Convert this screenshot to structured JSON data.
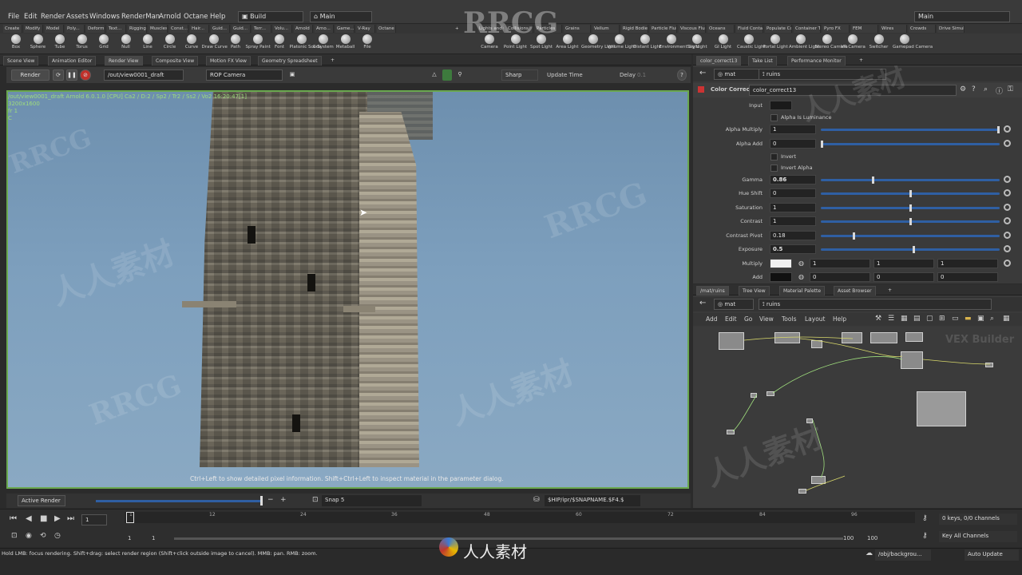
{
  "menubar": {
    "items": [
      "File",
      "Edit",
      "Render",
      "Assets",
      "Windows",
      "RenderMan",
      "Arnold",
      "Octane",
      "Help"
    ],
    "desktop": "Build",
    "context": "Main",
    "right_context": "Main"
  },
  "shelf_tabs": [
    "Create",
    "Modify",
    "Model",
    "Poly...",
    "Deform",
    "Text...",
    "Rigging",
    "Muscles",
    "Const...",
    "Hair...",
    "Guid...",
    "Guid...",
    "Terr...",
    "Volu...",
    "Arnold",
    "Arno...",
    "Game...",
    "V-Ray",
    "Octane",
    "Lights and C...",
    "Collisions",
    "Particles",
    "Grains",
    "Vellum",
    "Rigid Bodies",
    "Particle Fluids",
    "Viscous Fluids",
    "Oceans",
    "Fluid Contai...",
    "Populate Con...",
    "Container Tools",
    "Pyro FX",
    "FEM",
    "Wires",
    "Crowds",
    "Drive Simula..."
  ],
  "shelf_tools_left": [
    "Box",
    "Sphere",
    "Tube",
    "Torus",
    "Grid",
    "Null",
    "Line",
    "Circle",
    "Curve",
    "Draw Curve",
    "Path",
    "Spray Paint",
    "Font",
    "Platonic Solids",
    "L-System",
    "Metaball",
    "File"
  ],
  "shelf_tools_right": [
    "Camera",
    "Point Light",
    "Spot Light",
    "Area Light",
    "Geometry Light",
    "Volume Light",
    "Distant Light",
    "Environment Light",
    "Sky Light",
    "GI Light",
    "Caustic Light",
    "Portal Light",
    "Ambient Light",
    "Stereo Camera",
    "VR Camera",
    "Switcher",
    "Gamepad Camera"
  ],
  "left_tabs": [
    "Scene View",
    "Animation Editor",
    "Render View",
    "Composite View",
    "Motion FX View",
    "Geometry Spreadsheet"
  ],
  "render_toolbar": {
    "render_button": "Render",
    "output_path": "/out/view0001_draft",
    "camera": "ROP Camera",
    "sharp": "Sharp",
    "update_time": "Update Time",
    "delay": "Delay",
    "delay_value": "0.1"
  },
  "viewport": {
    "info_line1": "/out/view0001_draft  Arnold 6.0.1.0 [CPU] Ca2 / D:2 / Sp2 / Tr2 / Ss2 / Vo2  16:20:47[1]",
    "info_line2": "3200x1600",
    "info_line3": "fr 1",
    "info_line4": "C",
    "hint": "Ctrl+Left to show detailed pixel information. Shift+Ctrl+Left to inspect material in the parameter dialog."
  },
  "render_bottom": {
    "mode": "Active Render",
    "snap": "Snap 5",
    "ipr_path": "$HIP/ipr/$SNAPNAME.$F4.$"
  },
  "timeline": {
    "ticks": [
      "1",
      "12",
      "24",
      "36",
      "48",
      "60",
      "72",
      "84",
      "96"
    ],
    "frame": "1",
    "start": "1",
    "start2": "1",
    "end": "100",
    "end2": "100",
    "keys": "0 keys, 0/0 channels",
    "key_all": "Key All Channels"
  },
  "status": {
    "text": "Hold LMB: focus rendering. Shift+drag: select render region (Shift+click outside image to cancel). MMB: pan. RMB: zoom.",
    "path": "/obj/backgrou...",
    "auto_update": "Auto Update"
  },
  "param_tabs": [
    "color_correct13",
    "Take List",
    "Performance Monitor"
  ],
  "param_path": {
    "context": "mat",
    "node": "ruins"
  },
  "param_header": {
    "type": "Color Correct",
    "name": "color_correct13"
  },
  "params": {
    "input_label": "Input",
    "alpha_is_luminance": "Alpha Is Luminance",
    "alpha_multiply": {
      "label": "Alpha Multiply",
      "value": "1",
      "frac": 1.0
    },
    "alpha_add": {
      "label": "Alpha Add",
      "value": "0",
      "frac": 0.0
    },
    "invert": "Invert",
    "invert_alpha": "Invert Alpha",
    "gamma": {
      "label": "Gamma",
      "value": "0.86",
      "frac": 0.29
    },
    "hue_shift": {
      "label": "Hue Shift",
      "value": "0",
      "frac": 0.5
    },
    "saturation": {
      "label": "Saturation",
      "value": "1",
      "frac": 0.5
    },
    "contrast": {
      "label": "Contrast",
      "value": "1",
      "frac": 0.5
    },
    "contrast_pivot": {
      "label": "Contrast Pivot",
      "value": "0.18",
      "frac": 0.18
    },
    "exposure": {
      "label": "Exposure",
      "value": "0.5",
      "frac": 0.52
    },
    "multiply": {
      "label": "Multiply",
      "values": [
        "1",
        "1",
        "1"
      ]
    },
    "add": {
      "label": "Add",
      "values": [
        "0",
        "0",
        "0"
      ]
    }
  },
  "network_tabs": [
    "/mat/ruins",
    "Tree View",
    "Material Palette",
    "Asset Browser"
  ],
  "network_path": {
    "context": "mat",
    "node": "ruins"
  },
  "network_menu": [
    "Add",
    "Edit",
    "Go",
    "View",
    "Tools",
    "Layout",
    "Help"
  ],
  "network_label": "VEX Builder",
  "watermarks": [
    "RRCG",
    "人人素材",
    "RRCG",
    "人人素材",
    "RRCG",
    "人人素材",
    "RRCG",
    "人人素材"
  ],
  "colors": {
    "accent_green": "#6aa84f",
    "slider_blue": "#2f5fa3",
    "sky": "#7d9fbd"
  }
}
